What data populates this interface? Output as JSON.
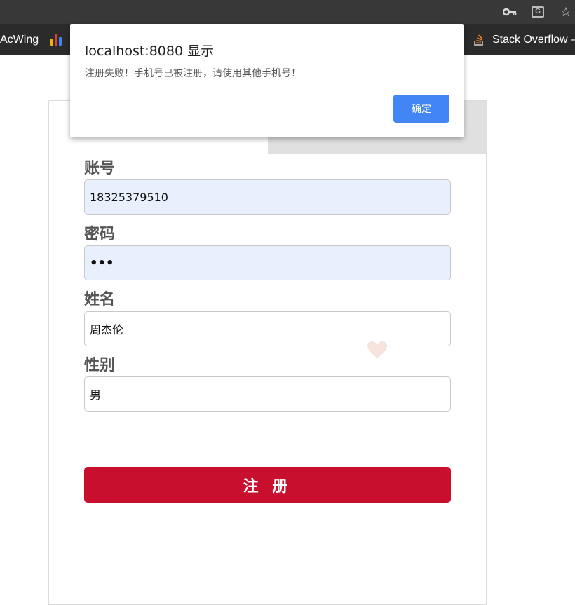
{
  "browser": {
    "icons": [
      "key-icon",
      "translate-icon",
      "star-icon"
    ],
    "bookmarks": [
      {
        "label": "AcWing"
      },
      {
        "label": ""
      },
      {
        "label": "Stack Overflow –"
      }
    ]
  },
  "form": {
    "fields": [
      {
        "label": "账号",
        "value": "18325379510",
        "autofill": true
      },
      {
        "label": "密码",
        "value": "•••",
        "autofill": true
      },
      {
        "label": "姓名",
        "value": "周杰伦",
        "autofill": false
      },
      {
        "label": "性别",
        "value": "男",
        "autofill": false
      }
    ],
    "submit_label": "注 册"
  },
  "dialog": {
    "title": "localhost:8080 显示",
    "message": "注册失败！手机号已被注册，请使用其他手机号！",
    "ok_label": "确定"
  },
  "colors": {
    "submit": "#c8102e",
    "dialog_button": "#4285f4",
    "autofill_bg": "#e8f0fe",
    "toolbar": "#383838",
    "bookmarks_bar": "#2b2b2b"
  }
}
